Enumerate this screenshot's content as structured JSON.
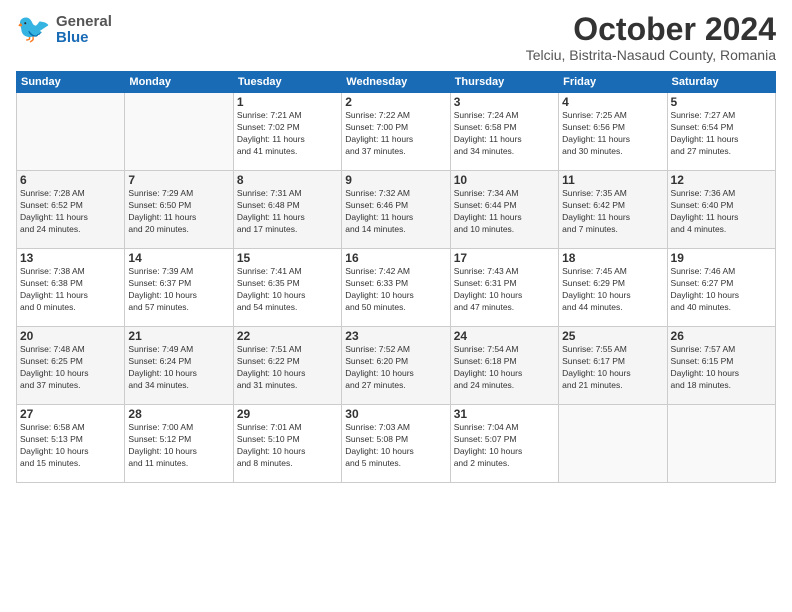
{
  "header": {
    "logo_general": "General",
    "logo_blue": "Blue",
    "month_title": "October 2024",
    "subtitle": "Telciu, Bistrita-Nasaud County, Romania"
  },
  "weekdays": [
    "Sunday",
    "Monday",
    "Tuesday",
    "Wednesday",
    "Thursday",
    "Friday",
    "Saturday"
  ],
  "weeks": [
    [
      {
        "day": "",
        "info": ""
      },
      {
        "day": "",
        "info": ""
      },
      {
        "day": "1",
        "info": "Sunrise: 7:21 AM\nSunset: 7:02 PM\nDaylight: 11 hours\nand 41 minutes."
      },
      {
        "day": "2",
        "info": "Sunrise: 7:22 AM\nSunset: 7:00 PM\nDaylight: 11 hours\nand 37 minutes."
      },
      {
        "day": "3",
        "info": "Sunrise: 7:24 AM\nSunset: 6:58 PM\nDaylight: 11 hours\nand 34 minutes."
      },
      {
        "day": "4",
        "info": "Sunrise: 7:25 AM\nSunset: 6:56 PM\nDaylight: 11 hours\nand 30 minutes."
      },
      {
        "day": "5",
        "info": "Sunrise: 7:27 AM\nSunset: 6:54 PM\nDaylight: 11 hours\nand 27 minutes."
      }
    ],
    [
      {
        "day": "6",
        "info": "Sunrise: 7:28 AM\nSunset: 6:52 PM\nDaylight: 11 hours\nand 24 minutes."
      },
      {
        "day": "7",
        "info": "Sunrise: 7:29 AM\nSunset: 6:50 PM\nDaylight: 11 hours\nand 20 minutes."
      },
      {
        "day": "8",
        "info": "Sunrise: 7:31 AM\nSunset: 6:48 PM\nDaylight: 11 hours\nand 17 minutes."
      },
      {
        "day": "9",
        "info": "Sunrise: 7:32 AM\nSunset: 6:46 PM\nDaylight: 11 hours\nand 14 minutes."
      },
      {
        "day": "10",
        "info": "Sunrise: 7:34 AM\nSunset: 6:44 PM\nDaylight: 11 hours\nand 10 minutes."
      },
      {
        "day": "11",
        "info": "Sunrise: 7:35 AM\nSunset: 6:42 PM\nDaylight: 11 hours\nand 7 minutes."
      },
      {
        "day": "12",
        "info": "Sunrise: 7:36 AM\nSunset: 6:40 PM\nDaylight: 11 hours\nand 4 minutes."
      }
    ],
    [
      {
        "day": "13",
        "info": "Sunrise: 7:38 AM\nSunset: 6:38 PM\nDaylight: 11 hours\nand 0 minutes."
      },
      {
        "day": "14",
        "info": "Sunrise: 7:39 AM\nSunset: 6:37 PM\nDaylight: 10 hours\nand 57 minutes."
      },
      {
        "day": "15",
        "info": "Sunrise: 7:41 AM\nSunset: 6:35 PM\nDaylight: 10 hours\nand 54 minutes."
      },
      {
        "day": "16",
        "info": "Sunrise: 7:42 AM\nSunset: 6:33 PM\nDaylight: 10 hours\nand 50 minutes."
      },
      {
        "day": "17",
        "info": "Sunrise: 7:43 AM\nSunset: 6:31 PM\nDaylight: 10 hours\nand 47 minutes."
      },
      {
        "day": "18",
        "info": "Sunrise: 7:45 AM\nSunset: 6:29 PM\nDaylight: 10 hours\nand 44 minutes."
      },
      {
        "day": "19",
        "info": "Sunrise: 7:46 AM\nSunset: 6:27 PM\nDaylight: 10 hours\nand 40 minutes."
      }
    ],
    [
      {
        "day": "20",
        "info": "Sunrise: 7:48 AM\nSunset: 6:25 PM\nDaylight: 10 hours\nand 37 minutes."
      },
      {
        "day": "21",
        "info": "Sunrise: 7:49 AM\nSunset: 6:24 PM\nDaylight: 10 hours\nand 34 minutes."
      },
      {
        "day": "22",
        "info": "Sunrise: 7:51 AM\nSunset: 6:22 PM\nDaylight: 10 hours\nand 31 minutes."
      },
      {
        "day": "23",
        "info": "Sunrise: 7:52 AM\nSunset: 6:20 PM\nDaylight: 10 hours\nand 27 minutes."
      },
      {
        "day": "24",
        "info": "Sunrise: 7:54 AM\nSunset: 6:18 PM\nDaylight: 10 hours\nand 24 minutes."
      },
      {
        "day": "25",
        "info": "Sunrise: 7:55 AM\nSunset: 6:17 PM\nDaylight: 10 hours\nand 21 minutes."
      },
      {
        "day": "26",
        "info": "Sunrise: 7:57 AM\nSunset: 6:15 PM\nDaylight: 10 hours\nand 18 minutes."
      }
    ],
    [
      {
        "day": "27",
        "info": "Sunrise: 6:58 AM\nSunset: 5:13 PM\nDaylight: 10 hours\nand 15 minutes."
      },
      {
        "day": "28",
        "info": "Sunrise: 7:00 AM\nSunset: 5:12 PM\nDaylight: 10 hours\nand 11 minutes."
      },
      {
        "day": "29",
        "info": "Sunrise: 7:01 AM\nSunset: 5:10 PM\nDaylight: 10 hours\nand 8 minutes."
      },
      {
        "day": "30",
        "info": "Sunrise: 7:03 AM\nSunset: 5:08 PM\nDaylight: 10 hours\nand 5 minutes."
      },
      {
        "day": "31",
        "info": "Sunrise: 7:04 AM\nSunset: 5:07 PM\nDaylight: 10 hours\nand 2 minutes."
      },
      {
        "day": "",
        "info": ""
      },
      {
        "day": "",
        "info": ""
      }
    ]
  ]
}
